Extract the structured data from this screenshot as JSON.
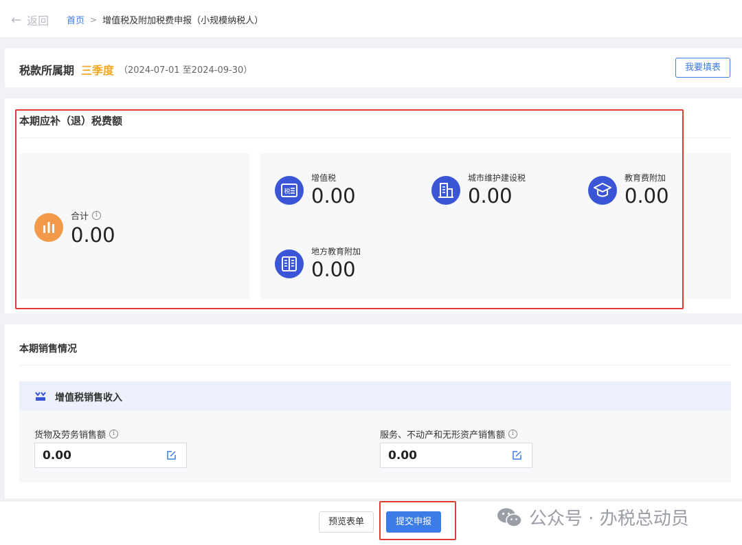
{
  "header": {
    "back_label": "返回",
    "breadcrumb": {
      "home": "首页",
      "separator": ">",
      "current": "增值税及附加税费申报（小规模纳税人）"
    }
  },
  "period": {
    "label": "税款所属期",
    "season": "三季度",
    "range": "（2024-07-01 至2024-09-30）",
    "fill_button": "我要填表"
  },
  "due": {
    "title": "本期应补（退）税费额",
    "total": {
      "label": "合计",
      "value": "0.00",
      "icon": "bar-chart-icon"
    },
    "items": [
      {
        "label": "增值税",
        "value": "0.00",
        "icon": "tax-document-icon"
      },
      {
        "label": "城市维护建设税",
        "value": "0.00",
        "icon": "building-icon"
      },
      {
        "label": "教育费附加",
        "value": "0.00",
        "icon": "graduation-cap-icon"
      },
      {
        "label": "地方教育附加",
        "value": "0.00",
        "icon": "book-icon"
      }
    ]
  },
  "sales": {
    "title": "本期销售情况",
    "subsection_title": "增值税销售收入",
    "fields": [
      {
        "label": "货物及劳务销售额",
        "value": "0.00"
      },
      {
        "label": "服务、不动产和无形资产销售额",
        "value": "0.00"
      }
    ]
  },
  "footer": {
    "preview_button": "预览表单",
    "submit_button": "提交申报",
    "watermark": "公众号 · 办税总动员"
  },
  "colors": {
    "accent": "#3b7ce8",
    "season": "#f5a623",
    "total_icon": "#f2994a",
    "tax_icon": "#3a55d6",
    "highlight_box": "#e23b32"
  }
}
